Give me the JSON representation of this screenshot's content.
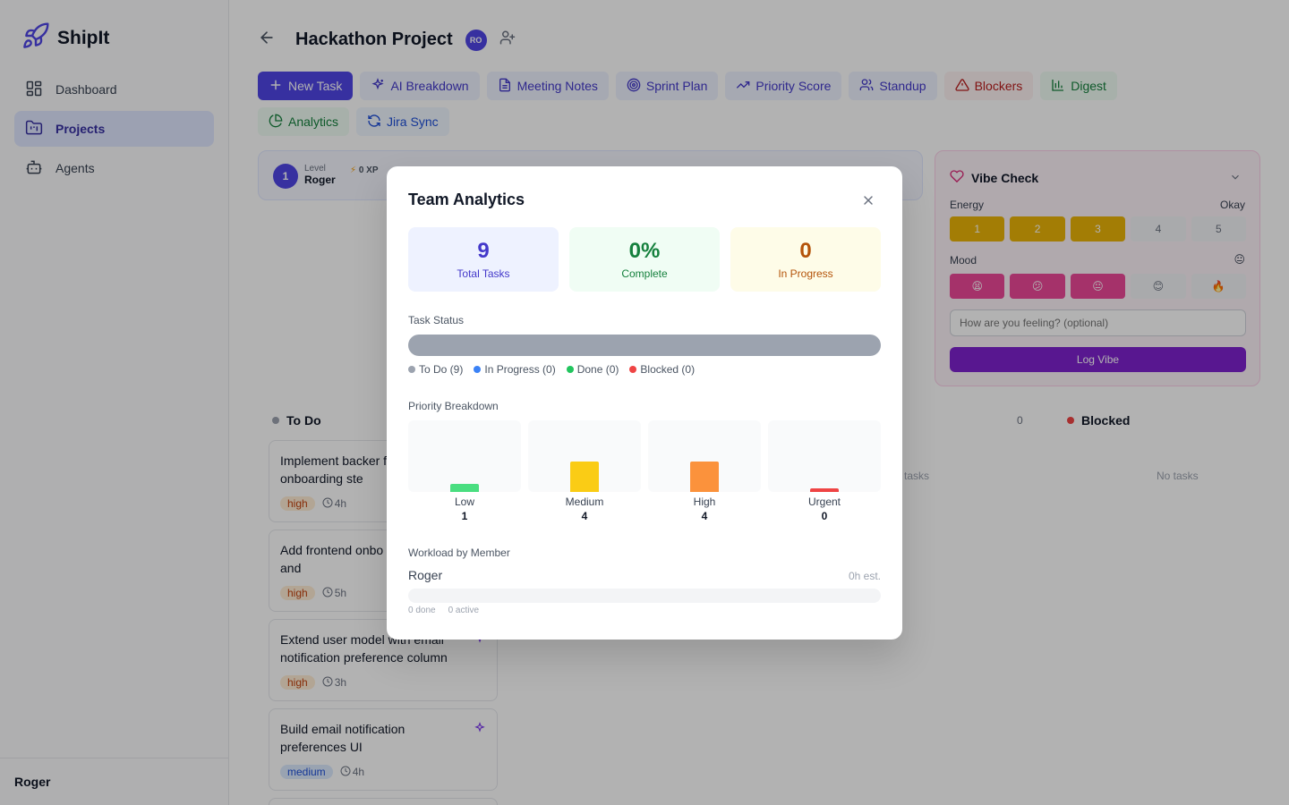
{
  "app": {
    "name": "ShipIt"
  },
  "sidebar": {
    "items": [
      {
        "label": "Dashboard",
        "icon": "dashboard-icon"
      },
      {
        "label": "Projects",
        "icon": "folder-icon"
      },
      {
        "label": "Agents",
        "icon": "robot-icon"
      }
    ],
    "user": "Roger"
  },
  "project": {
    "title": "Hackathon Project",
    "avatar_initials": "RO"
  },
  "toolbar": {
    "new_task": "New Task",
    "ai_breakdown": "AI Breakdown",
    "meeting_notes": "Meeting Notes",
    "sprint_plan": "Sprint Plan",
    "priority_score": "Priority Score",
    "standup": "Standup",
    "blockers": "Blockers",
    "digest": "Digest",
    "analytics": "Analytics",
    "jira_sync": "Jira Sync"
  },
  "level": {
    "value": "1",
    "label": "Level",
    "user": "Roger",
    "xp": "0 XP"
  },
  "vibe": {
    "title": "Vibe Check",
    "energy_label": "Energy",
    "energy_status": "Okay",
    "energy_scale": [
      "1",
      "2",
      "3",
      "4",
      "5"
    ],
    "mood_label": "Mood",
    "mood_status": "😐",
    "mood_scale": [
      "😫",
      "😕",
      "😐",
      "😊",
      "🔥"
    ],
    "placeholder": "How are you feeling? (optional)",
    "button": "Log Vibe"
  },
  "board": {
    "todo_label": "To Do",
    "count_label": "0",
    "blocked_label": "Blocked",
    "no_tasks_partial": "o tasks",
    "no_tasks": "No tasks",
    "tasks": [
      {
        "title": "Implement backer for onboarding ste",
        "priority": "high",
        "estimate": "4h"
      },
      {
        "title": "Add frontend onbo progress bar and",
        "priority": "high",
        "estimate": "5h"
      },
      {
        "title": "Extend user model with email notification preference column",
        "priority": "high",
        "estimate": "3h"
      },
      {
        "title": "Build email notification preferences UI",
        "priority": "medium",
        "estimate": "4h"
      }
    ]
  },
  "modal": {
    "title": "Team Analytics",
    "stats": [
      {
        "value": "9",
        "label": "Total Tasks"
      },
      {
        "value": "0%",
        "label": "Complete"
      },
      {
        "value": "0",
        "label": "In Progress"
      }
    ],
    "task_status_title": "Task Status",
    "status_legend": [
      {
        "label": "To Do (9)",
        "color": "#9ca3af"
      },
      {
        "label": "In Progress (0)",
        "color": "#3b82f6"
      },
      {
        "label": "Done (0)",
        "color": "#22c55e"
      },
      {
        "label": "Blocked (0)",
        "color": "#ef4444"
      }
    ],
    "priority_title": "Priority Breakdown",
    "priorities": [
      {
        "label": "Low",
        "value": "1",
        "count": 1,
        "color": "#4ade80"
      },
      {
        "label": "Medium",
        "value": "4",
        "count": 4,
        "color": "#facc15"
      },
      {
        "label": "High",
        "value": "4",
        "count": 4,
        "color": "#fb923c"
      },
      {
        "label": "Urgent",
        "value": "0",
        "count": 0,
        "color": "#ef4444"
      }
    ],
    "workload_title": "Workload by Member",
    "member": {
      "name": "Roger",
      "estimate": "0h est.",
      "done": "0 done",
      "active": "0 active"
    }
  }
}
